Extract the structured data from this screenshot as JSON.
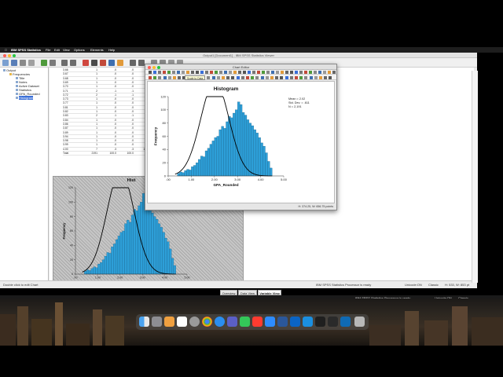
{
  "menubar": {
    "app_name": "IBM SPSS Statistics",
    "items": [
      "File",
      "Edit",
      "View",
      "Options",
      "Elements",
      "Help"
    ]
  },
  "viewer": {
    "title": "Output1 [Document1] - IBM SPSS Statistics Viewer"
  },
  "outline": {
    "items": [
      {
        "label": "Output",
        "level": 0
      },
      {
        "label": "Frequencies",
        "level": 1
      },
      {
        "label": "Title",
        "level": 2
      },
      {
        "label": "Notes",
        "level": 2
      },
      {
        "label": "Active Dataset",
        "level": 2
      },
      {
        "label": "Statistics",
        "level": 2
      },
      {
        "label": "GPA_Rounded",
        "level": 2
      },
      {
        "label": "Histogram",
        "level": 2,
        "selected": true
      }
    ]
  },
  "freq_table": {
    "rows": [
      [
        "3.66",
        "1",
        ".0",
        ".0",
        "95"
      ],
      [
        "3.67",
        "1",
        ".0",
        ".0",
        "95"
      ],
      [
        "3.68",
        "1",
        ".0",
        ".0",
        "95"
      ],
      [
        "3.69",
        "1",
        ".0",
        ".0",
        "96"
      ],
      [
        "3.70",
        "1",
        ".0",
        ".0",
        "96"
      ],
      [
        "3.71",
        "2",
        ".1",
        ".1",
        "96"
      ],
      [
        "3.72",
        "2",
        ".1",
        ".1",
        "96"
      ],
      [
        "3.73",
        "1",
        ".0",
        ".0",
        "96"
      ],
      [
        "3.77",
        "1",
        ".0",
        ".0",
        "97"
      ],
      [
        "3.81",
        "1",
        ".0",
        ".0",
        "97"
      ],
      [
        "3.82",
        "1",
        ".0",
        ".0",
        "97"
      ],
      [
        "3.83",
        "2",
        ".1",
        ".1",
        "97"
      ],
      [
        "3.84",
        "1",
        ".0",
        ".0",
        "98"
      ],
      [
        "3.86",
        "1",
        ".0",
        ".0",
        "98"
      ],
      [
        "3.87",
        "1",
        ".0",
        ".0",
        "98"
      ],
      [
        "3.89",
        "1",
        ".0",
        ".0",
        "98"
      ],
      [
        "3.94",
        "1",
        ".0",
        ".0",
        "99"
      ],
      [
        "3.98",
        "1",
        ".0",
        ".0",
        "99"
      ],
      [
        "3.99",
        "1",
        ".0",
        ".0",
        "99"
      ],
      [
        "4.00",
        "7",
        ".3",
        ".3",
        "100"
      ],
      [
        "Total",
        "2191",
        "100.0",
        "100.0",
        ""
      ]
    ]
  },
  "chart_editor": {
    "title": "Chart Editor",
    "tooltip": "Scale to Data",
    "status": "H: 374.25, W: 656.75 points"
  },
  "chart_data": {
    "type": "bar",
    "title": "Histogram",
    "xlabel": "GPA_Rounded",
    "ylabel": "Frequency",
    "xlim": [
      0,
      5
    ],
    "ylim": [
      0,
      120
    ],
    "x_ticks": [
      ".00",
      "1.00",
      "2.00",
      "3.00",
      "4.00",
      "5.00"
    ],
    "y_ticks": [
      "0",
      "20",
      "40",
      "60",
      "80",
      "100",
      "120"
    ],
    "stats": [
      "Mean = 2.02",
      "Std. Dev. = .611",
      "N = 2,191"
    ],
    "bin_start": 0.4,
    "bin_width": 0.1,
    "values": [
      4,
      6,
      5,
      8,
      10,
      9,
      14,
      16,
      20,
      25,
      30,
      29,
      38,
      42,
      48,
      53,
      58,
      60,
      70,
      75,
      72,
      82,
      90,
      88,
      95,
      100,
      112,
      108,
      96,
      92,
      85,
      80,
      76,
      70,
      65,
      58,
      50,
      45,
      35,
      22,
      12
    ],
    "normal_curve": {
      "mean": 2.02,
      "sd": 0.611,
      "n": 2191
    }
  },
  "thumb_chart": {
    "xlabel": "GPA_Rounded",
    "ylabel": "Frequency",
    "title": "Hist"
  },
  "status": {
    "left": "Double click to edit Chart",
    "processor": "IBM SPSS Statistics Processor is ready",
    "unicode": "Unicode:ON",
    "classic": "Classic",
    "dims": "H: 533, W: 853 pt"
  },
  "bottom_tabs": [
    "Overview",
    "Data View",
    "Variable View"
  ],
  "outer_status": {
    "processor": "IBM SPSS Statistics Processor is ready",
    "unicode": "Unicode:ON",
    "classic": "Classic"
  }
}
